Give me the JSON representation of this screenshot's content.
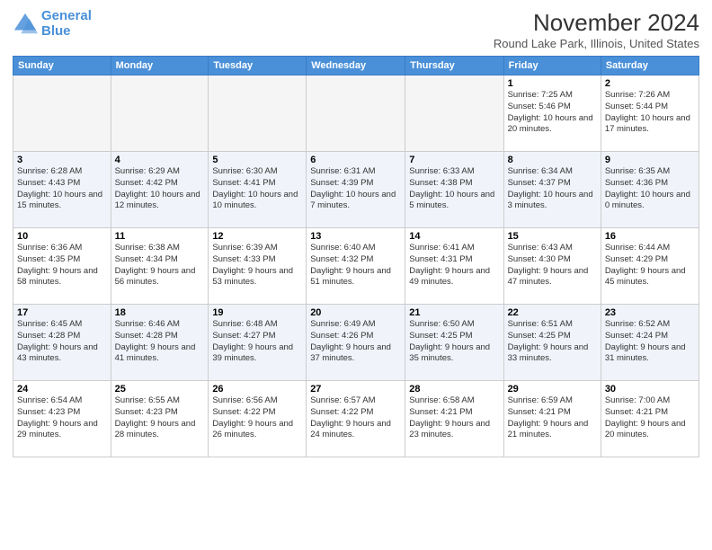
{
  "logo": {
    "line1": "General",
    "line2": "Blue"
  },
  "title": "November 2024",
  "subtitle": "Round Lake Park, Illinois, United States",
  "weekdays": [
    "Sunday",
    "Monday",
    "Tuesday",
    "Wednesday",
    "Thursday",
    "Friday",
    "Saturday"
  ],
  "weeks": [
    [
      {
        "day": "",
        "info": ""
      },
      {
        "day": "",
        "info": ""
      },
      {
        "day": "",
        "info": ""
      },
      {
        "day": "",
        "info": ""
      },
      {
        "day": "",
        "info": ""
      },
      {
        "day": "1",
        "info": "Sunrise: 7:25 AM\nSunset: 5:46 PM\nDaylight: 10 hours and 20 minutes."
      },
      {
        "day": "2",
        "info": "Sunrise: 7:26 AM\nSunset: 5:44 PM\nDaylight: 10 hours and 17 minutes."
      }
    ],
    [
      {
        "day": "3",
        "info": "Sunrise: 6:28 AM\nSunset: 4:43 PM\nDaylight: 10 hours and 15 minutes."
      },
      {
        "day": "4",
        "info": "Sunrise: 6:29 AM\nSunset: 4:42 PM\nDaylight: 10 hours and 12 minutes."
      },
      {
        "day": "5",
        "info": "Sunrise: 6:30 AM\nSunset: 4:41 PM\nDaylight: 10 hours and 10 minutes."
      },
      {
        "day": "6",
        "info": "Sunrise: 6:31 AM\nSunset: 4:39 PM\nDaylight: 10 hours and 7 minutes."
      },
      {
        "day": "7",
        "info": "Sunrise: 6:33 AM\nSunset: 4:38 PM\nDaylight: 10 hours and 5 minutes."
      },
      {
        "day": "8",
        "info": "Sunrise: 6:34 AM\nSunset: 4:37 PM\nDaylight: 10 hours and 3 minutes."
      },
      {
        "day": "9",
        "info": "Sunrise: 6:35 AM\nSunset: 4:36 PM\nDaylight: 10 hours and 0 minutes."
      }
    ],
    [
      {
        "day": "10",
        "info": "Sunrise: 6:36 AM\nSunset: 4:35 PM\nDaylight: 9 hours and 58 minutes."
      },
      {
        "day": "11",
        "info": "Sunrise: 6:38 AM\nSunset: 4:34 PM\nDaylight: 9 hours and 56 minutes."
      },
      {
        "day": "12",
        "info": "Sunrise: 6:39 AM\nSunset: 4:33 PM\nDaylight: 9 hours and 53 minutes."
      },
      {
        "day": "13",
        "info": "Sunrise: 6:40 AM\nSunset: 4:32 PM\nDaylight: 9 hours and 51 minutes."
      },
      {
        "day": "14",
        "info": "Sunrise: 6:41 AM\nSunset: 4:31 PM\nDaylight: 9 hours and 49 minutes."
      },
      {
        "day": "15",
        "info": "Sunrise: 6:43 AM\nSunset: 4:30 PM\nDaylight: 9 hours and 47 minutes."
      },
      {
        "day": "16",
        "info": "Sunrise: 6:44 AM\nSunset: 4:29 PM\nDaylight: 9 hours and 45 minutes."
      }
    ],
    [
      {
        "day": "17",
        "info": "Sunrise: 6:45 AM\nSunset: 4:28 PM\nDaylight: 9 hours and 43 minutes."
      },
      {
        "day": "18",
        "info": "Sunrise: 6:46 AM\nSunset: 4:28 PM\nDaylight: 9 hours and 41 minutes."
      },
      {
        "day": "19",
        "info": "Sunrise: 6:48 AM\nSunset: 4:27 PM\nDaylight: 9 hours and 39 minutes."
      },
      {
        "day": "20",
        "info": "Sunrise: 6:49 AM\nSunset: 4:26 PM\nDaylight: 9 hours and 37 minutes."
      },
      {
        "day": "21",
        "info": "Sunrise: 6:50 AM\nSunset: 4:25 PM\nDaylight: 9 hours and 35 minutes."
      },
      {
        "day": "22",
        "info": "Sunrise: 6:51 AM\nSunset: 4:25 PM\nDaylight: 9 hours and 33 minutes."
      },
      {
        "day": "23",
        "info": "Sunrise: 6:52 AM\nSunset: 4:24 PM\nDaylight: 9 hours and 31 minutes."
      }
    ],
    [
      {
        "day": "24",
        "info": "Sunrise: 6:54 AM\nSunset: 4:23 PM\nDaylight: 9 hours and 29 minutes."
      },
      {
        "day": "25",
        "info": "Sunrise: 6:55 AM\nSunset: 4:23 PM\nDaylight: 9 hours and 28 minutes."
      },
      {
        "day": "26",
        "info": "Sunrise: 6:56 AM\nSunset: 4:22 PM\nDaylight: 9 hours and 26 minutes."
      },
      {
        "day": "27",
        "info": "Sunrise: 6:57 AM\nSunset: 4:22 PM\nDaylight: 9 hours and 24 minutes."
      },
      {
        "day": "28",
        "info": "Sunrise: 6:58 AM\nSunset: 4:21 PM\nDaylight: 9 hours and 23 minutes."
      },
      {
        "day": "29",
        "info": "Sunrise: 6:59 AM\nSunset: 4:21 PM\nDaylight: 9 hours and 21 minutes."
      },
      {
        "day": "30",
        "info": "Sunrise: 7:00 AM\nSunset: 4:21 PM\nDaylight: 9 hours and 20 minutes."
      }
    ]
  ]
}
